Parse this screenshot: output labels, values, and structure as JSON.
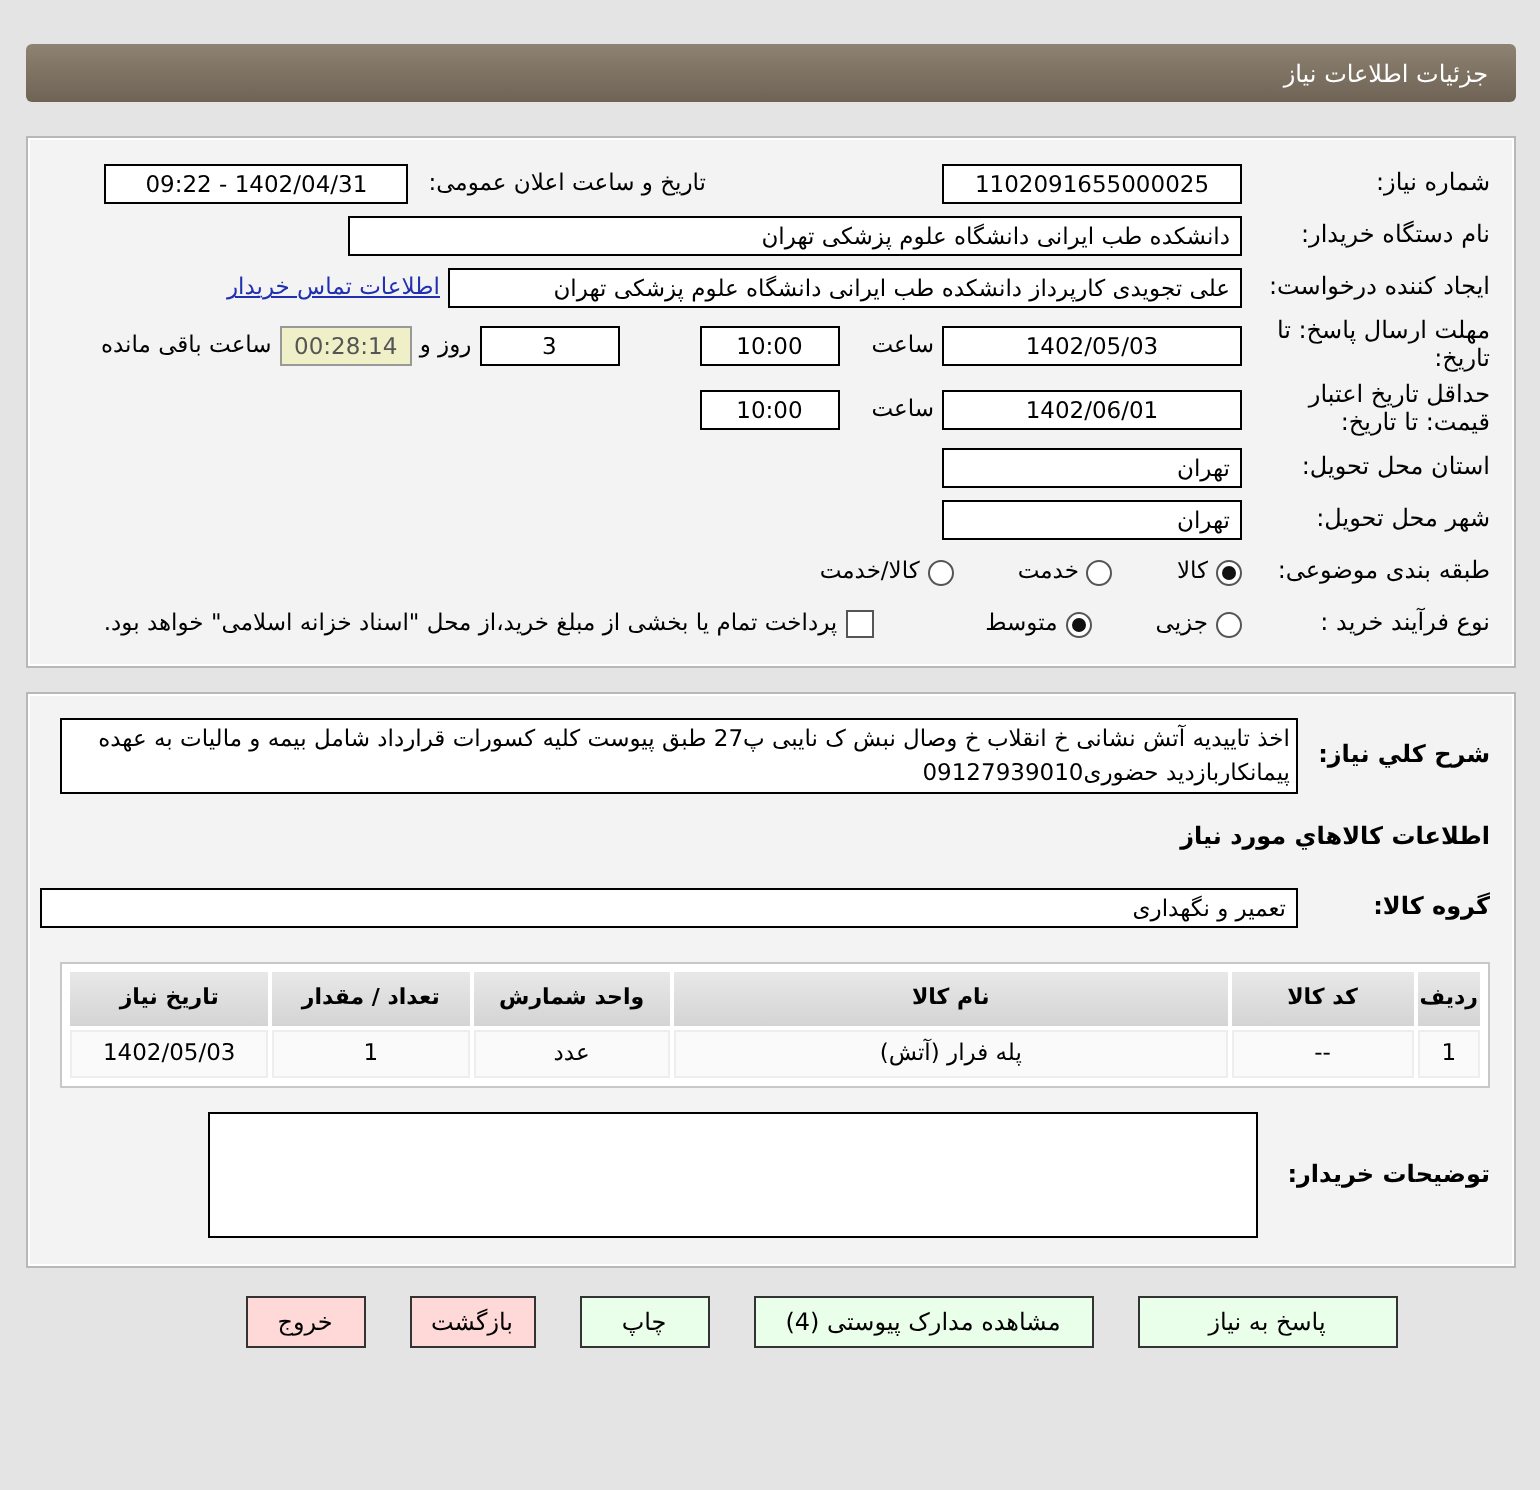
{
  "header": {
    "title": "جزئیات اطلاعات نیاز"
  },
  "need_info": {
    "need_number": {
      "label": "شماره نیاز:",
      "value": "1102091655000025"
    },
    "announce": {
      "label": "تاریخ و ساعت اعلان عمومی:",
      "value": "1402/04/31 - 09:22"
    },
    "buyer_org": {
      "label": "نام دستگاه خریدار:",
      "value": "دانشکده طب ایرانی دانشگاه علوم پزشکی تهران"
    },
    "requester": {
      "label": "ایجاد کننده درخواست:",
      "value": "علی تجویدی کارپرداز دانشکده طب ایرانی دانشگاه علوم پزشکی تهران",
      "link": "اطلاعات تماس خریدار"
    },
    "reply_deadline": {
      "label": "مهلت ارسال پاسخ: تا تاریخ:",
      "date": "1402/05/03",
      "time_label": "ساعت",
      "time": "10:00",
      "days": "3",
      "days_label": "روز و",
      "remaining": "00:28:14",
      "remaining_label": "ساعت باقی مانده"
    },
    "price_validity": {
      "label": "حداقل تاریخ اعتبار قیمت: تا تاریخ:",
      "date": "1402/06/01",
      "time_label": "ساعت",
      "time": "10:00"
    },
    "province": {
      "label": "استان محل تحویل:",
      "value": "تهران"
    },
    "city": {
      "label": "شهر محل تحویل:",
      "value": "تهران"
    },
    "category": {
      "label": "طبقه بندی موضوعی:",
      "options": [
        {
          "label": "کالا",
          "selected": true
        },
        {
          "label": "خدمت",
          "selected": false
        },
        {
          "label": "کالا/خدمت",
          "selected": false
        }
      ]
    },
    "purchase_type": {
      "label": "نوع فرآیند خرید :",
      "options": [
        {
          "label": "جزیی",
          "selected": false
        },
        {
          "label": "متوسط",
          "selected": true
        }
      ],
      "payment": {
        "checked": false,
        "text": "پرداخت تمام یا بخشی از مبلغ خرید،از محل \"اسناد خزانه اسلامی\" خواهد بود."
      }
    }
  },
  "details": {
    "description": {
      "label": "شرح کلي نياز:",
      "value": "اخذ تاییدیه آتش نشانی  خ انقلاب خ وصال نبش ک نایبی پ27 طبق پیوست کلیه کسورات قرارداد شامل بیمه و مالیات به عهده پیمانکاربازدید حضوری09127939010"
    },
    "items_heading": "اطلاعات کالاهاي مورد نياز",
    "goods_group": {
      "label": "گروه کالا:",
      "value": "تعمیر و نگهداری"
    },
    "table": {
      "columns": [
        "ردیف",
        "کد کالا",
        "نام کالا",
        "واحد شمارش",
        "تعداد / مقدار",
        "تاریخ نیاز"
      ],
      "rows": [
        [
          "1",
          "--",
          "پله فرار (آتش)",
          "عدد",
          "1",
          "1402/05/03"
        ]
      ]
    },
    "buyer_notes": {
      "label": "توضیحات خریدار:"
    }
  },
  "buttons": [
    {
      "label": "پاسخ به نیاز",
      "kind": "action"
    },
    {
      "label": "مشاهده مدارک پیوستی (4)",
      "kind": "action"
    },
    {
      "label": "چاپ",
      "kind": "action"
    },
    {
      "label": "بازگشت",
      "kind": "exit"
    },
    {
      "label": "خروج",
      "kind": "exit"
    }
  ]
}
